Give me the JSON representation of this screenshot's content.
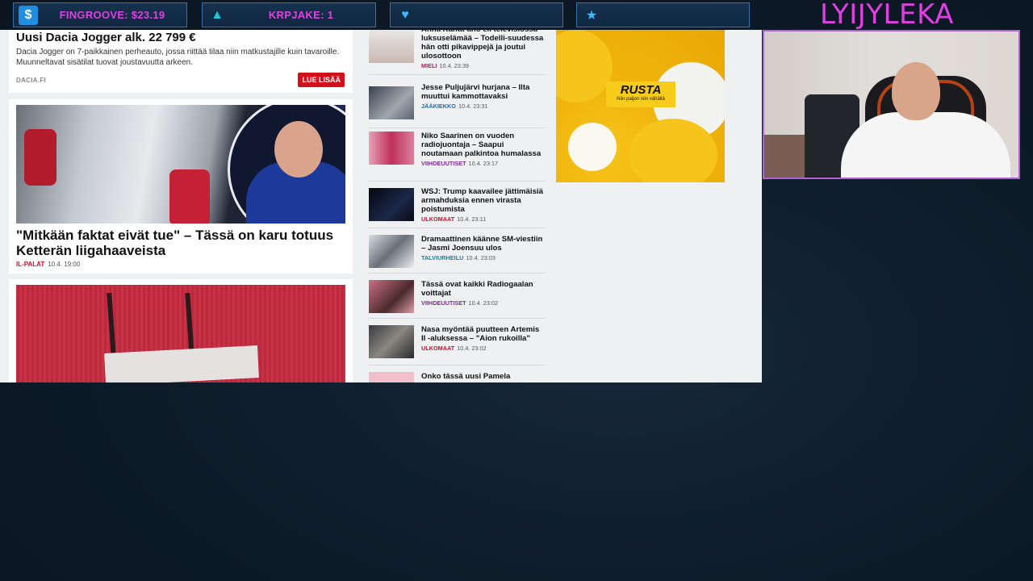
{
  "overlay": {
    "alerts": [
      {
        "icon": "dollar-icon",
        "glyph": "$",
        "text": "FINGROOVE: $23.19"
      },
      {
        "icon": "droplet-icon",
        "glyph": "▲",
        "text": "KRPJAKE: 1"
      },
      {
        "icon": "heart-icon",
        "glyph": "♥",
        "text": ""
      },
      {
        "icon": "star-icon",
        "glyph": "★",
        "text": ""
      }
    ],
    "streamer_name": "LYIJYLEKA",
    "accent_color": "#e040e0"
  },
  "browser": {
    "ad": {
      "title": "Uusi Dacia Jogger alk. 22 799 €",
      "text": "Dacia Jogger on 7-paikkainen perheauto, jossa riittää tilaa niin matkustajille kuin tavaroille. Muunneltavat sisätilat tuovat joustavuutta arkeen.",
      "source": "DACIA.FI",
      "button": "LUE LISÄÄ"
    },
    "story": {
      "headline": "\"Mitkään faktat eivät tue\" – Tässä on karu totuus Ketterän liigahaaveista",
      "category": "IL-PALAT",
      "time": "10.4. 19:00"
    },
    "news": [
      {
        "title": "Anna Kanta-aho eli televisiossa luksuselämää – Todelli-suudessa hän otti pikavippejä ja joutui ulosottoon",
        "category": "MIELI",
        "time": "10.4. 23:39"
      },
      {
        "title": "Jesse Puljujärvi hurjana – Ilta muuttui kammottavaksi",
        "category": "JÄÄKIEKKO",
        "time": "10.4. 23:31"
      },
      {
        "title": "Niko Saarinen on vuoden radiojuontaja – Saapui noutamaan palkintoa humalassa",
        "category": "VIIHDEUUTISET",
        "time": "10.4. 23:17"
      },
      {
        "title": "WSJ: Trump kaavailee jättimäisiä armahduksia ennen virasta poistumista",
        "category": "ULKOMAAT",
        "time": "10.4. 23:11"
      },
      {
        "title": "Dramaattinen käänne SM-viestiin – Jasmi Joensuu ulos",
        "category": "TALVIURHEILU",
        "time": "10.4. 23:03"
      },
      {
        "title": "Tässä ovat kaikki Radiogaalan voittajat",
        "category": "VIIHDEUUTISET",
        "time": "10.4. 23:02"
      },
      {
        "title": "Nasa myöntää puutteen Artemis II -aluksessa – \"Aion rukoilla\"",
        "category": "ULKOMAAT",
        "time": "10.4. 23:02"
      },
      {
        "title": "Onko tässä uusi Pamela",
        "category": "",
        "time": ""
      }
    ],
    "promo": {
      "brand": "RUSTA",
      "tagline": "Niin paljon niin vähällä"
    }
  }
}
